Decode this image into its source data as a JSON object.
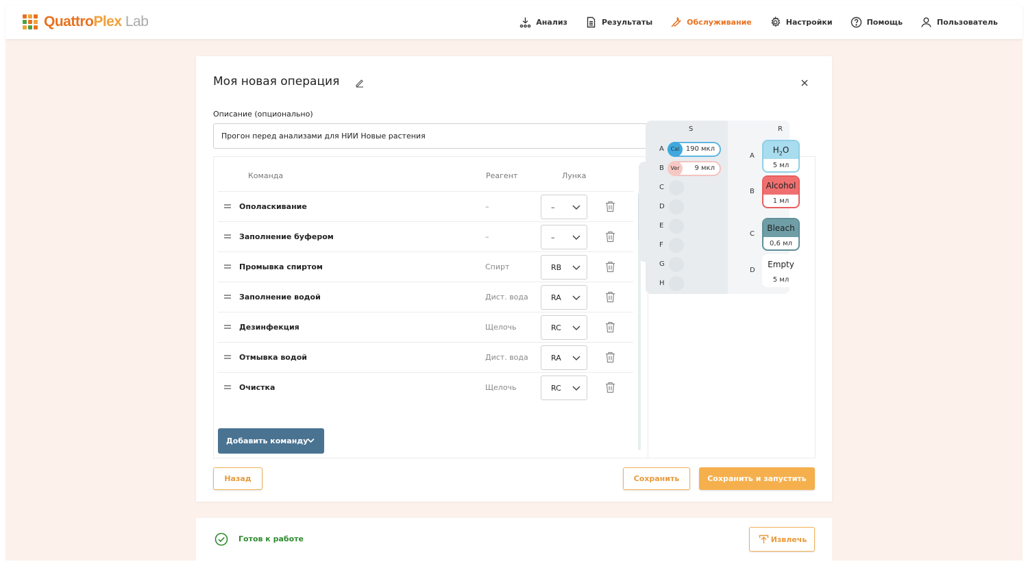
{
  "app": {
    "logo_part1": "Quattro",
    "logo_part2": "Plex",
    "logo_part3": " Lab",
    "logo_colors": [
      "#e8711f",
      "#f0a13a",
      "#e8711f",
      "#4ea03e",
      "#e8711f",
      "#f0a13a",
      "#f0a13a",
      "#4ea03e",
      "#e8711f"
    ]
  },
  "nav": {
    "items": [
      {
        "label": "Анализ",
        "icon": "analysis-icon",
        "active": false
      },
      {
        "label": "Результаты",
        "icon": "document-icon",
        "active": false
      },
      {
        "label": "Обслуживание",
        "icon": "wrench-icon",
        "active": true
      },
      {
        "label": "Настройки",
        "icon": "gear-icon",
        "active": false
      },
      {
        "label": "Помощь",
        "icon": "help-icon",
        "active": false
      },
      {
        "label": "Пользователь",
        "icon": "user-icon",
        "active": false
      }
    ]
  },
  "operation": {
    "title": "Моя новая операция",
    "description_label": "Описание (опционально)",
    "description_value": "Прогон перед анализами для НИИ Новые растения"
  },
  "table": {
    "headers": {
      "command": "Команда",
      "reagent": "Реагент",
      "well": "Лунка"
    },
    "rows": [
      {
        "command": "Ополаскивание",
        "reagent": "–",
        "well": "–"
      },
      {
        "command": "Заполнение буфером",
        "reagent": "–",
        "well": "–"
      },
      {
        "command": "Промывка спиртом",
        "reagent": "Спирт",
        "well": "RB"
      },
      {
        "command": "Заполнение водой",
        "reagent": "Дист. вода",
        "well": "RA"
      },
      {
        "command": "Дезинфекция",
        "reagent": "Щелочь",
        "well": "RC"
      },
      {
        "command": "Отмывка водой",
        "reagent": "Дист. вода",
        "well": "RA"
      },
      {
        "command": "Очистка",
        "reagent": "Щелочь",
        "well": "RC"
      }
    ],
    "add_command_label": "Добавить команду"
  },
  "plate": {
    "col_s": "S",
    "col_r": "R",
    "s_rows": [
      "A",
      "B",
      "C",
      "D",
      "E",
      "F",
      "G",
      "H"
    ],
    "samples": [
      {
        "row": "A",
        "code": "Cal",
        "volume": "190 мкл",
        "color": "#3fa9df"
      },
      {
        "row": "B",
        "code": "Ver",
        "volume": "9 мкл",
        "color": "#f7c8c3"
      }
    ],
    "reagents": [
      {
        "row": "A",
        "name_main": "H",
        "name_sub": "2",
        "name_tail": "O",
        "volume": "5 мл",
        "color": "#a8dcef",
        "border": "#8fcfe6"
      },
      {
        "row": "B",
        "name_main": "Alcohol",
        "name_sub": "",
        "name_tail": "",
        "volume": "1 мл",
        "color": "#f07070",
        "border": "#e85c5c"
      },
      {
        "row": "C",
        "name_main": "Bleach",
        "name_sub": "",
        "name_tail": "",
        "volume": "0,6 мл",
        "color": "#6f9ea6",
        "border": "#5f8f98"
      },
      {
        "row": "D",
        "name_main": "Empty",
        "name_sub": "",
        "name_tail": "",
        "volume": "5 мл",
        "color": "#ffffff",
        "border": "#ffffff"
      }
    ]
  },
  "actions": {
    "back": "Назад",
    "save": "Сохранить",
    "save_run": "Сохранить и запустить"
  },
  "status": {
    "text": "Готов к работе",
    "eject": "Извлечь",
    "ok_color": "#2f8b2f"
  }
}
